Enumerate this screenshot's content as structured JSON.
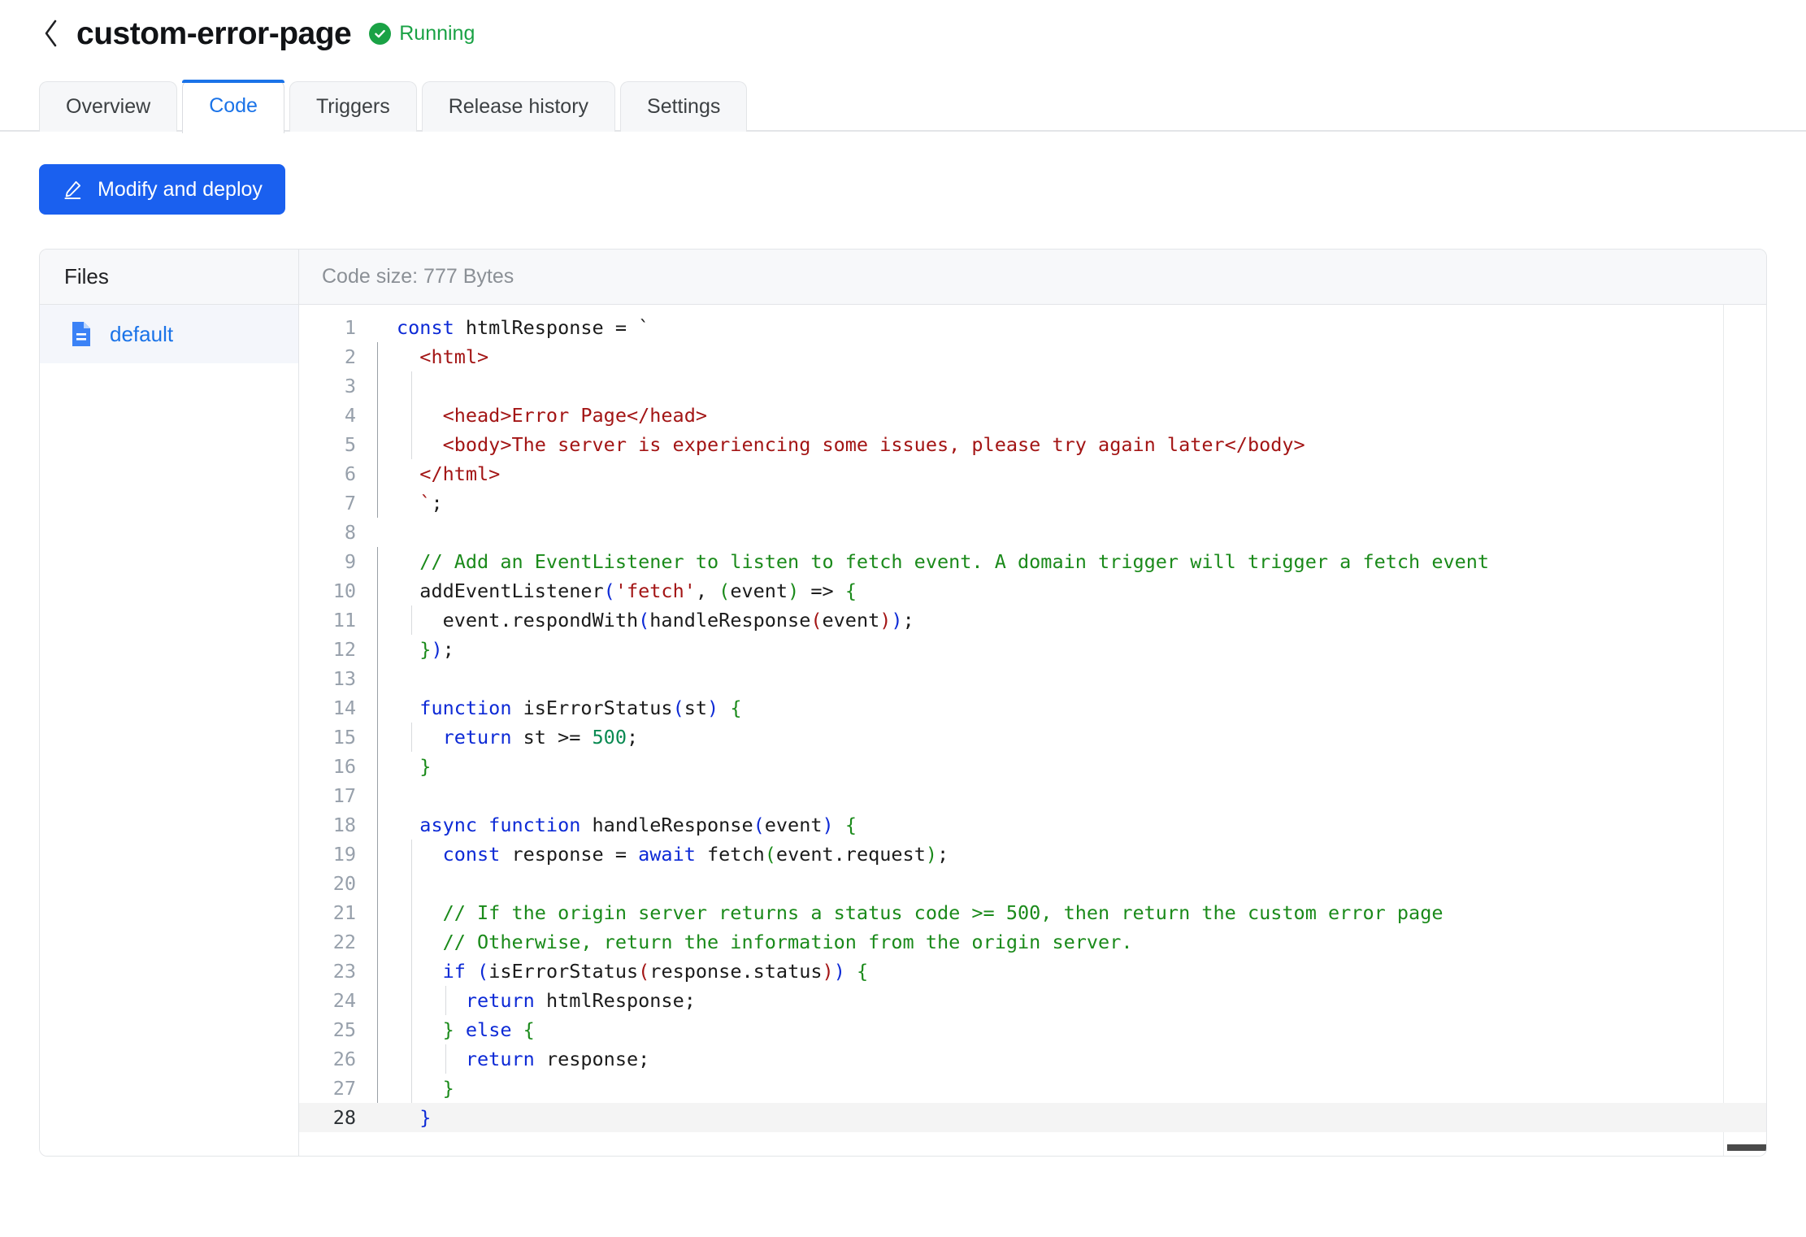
{
  "header": {
    "back_icon": "chevron-left-icon",
    "title": "custom-error-page",
    "status": {
      "icon": "check-circle-icon",
      "label": "Running",
      "color": "#1aa245"
    }
  },
  "tabs": [
    {
      "label": "Overview",
      "active": false
    },
    {
      "label": "Code",
      "active": true
    },
    {
      "label": "Triggers",
      "active": false
    },
    {
      "label": "Release history",
      "active": false
    },
    {
      "label": "Settings",
      "active": false
    }
  ],
  "toolbar": {
    "modify_deploy_label": "Modify and deploy",
    "modify_deploy_icon": "pencil-icon",
    "accent_color": "#1a60ef"
  },
  "files_panel": {
    "header": "Files",
    "items": [
      {
        "icon": "file-document-icon",
        "label": "default",
        "selected": true
      }
    ]
  },
  "editor": {
    "code_size_label": "Code size: 777 Bytes",
    "active_line": 28,
    "lines": [
      {
        "n": "1",
        "indent_levels": 0,
        "tokens": [
          {
            "t": "const ",
            "c": "k"
          },
          {
            "t": "htmlResponse = `",
            "c": "pl"
          }
        ]
      },
      {
        "n": "2",
        "indent_levels": 1,
        "tokens": [
          {
            "t": "  ",
            "c": "pl"
          },
          {
            "t": "<html>",
            "c": "s"
          }
        ]
      },
      {
        "n": "3",
        "indent_levels": 2,
        "tokens": [
          {
            "t": "",
            "c": "pl"
          }
        ]
      },
      {
        "n": "4",
        "indent_levels": 2,
        "tokens": [
          {
            "t": "    ",
            "c": "pl"
          },
          {
            "t": "<head>Error Page</head>",
            "c": "s"
          }
        ]
      },
      {
        "n": "5",
        "indent_levels": 2,
        "tokens": [
          {
            "t": "    ",
            "c": "pl"
          },
          {
            "t": "<body>The server is experiencing some issues, please try again later</body>",
            "c": "s"
          }
        ]
      },
      {
        "n": "6",
        "indent_levels": 1,
        "tokens": [
          {
            "t": "  ",
            "c": "pl"
          },
          {
            "t": "</html>",
            "c": "s"
          }
        ]
      },
      {
        "n": "7",
        "indent_levels": 1,
        "tokens": [
          {
            "t": "  `",
            "c": "s"
          },
          {
            "t": ";",
            "c": "pl"
          }
        ]
      },
      {
        "n": "8",
        "indent_levels": 0,
        "tokens": [
          {
            "t": "",
            "c": "pl"
          }
        ]
      },
      {
        "n": "9",
        "indent_levels": 1,
        "tokens": [
          {
            "t": "  // Add an EventListener to listen to fetch event. A domain trigger will trigger a fetch event",
            "c": "cm"
          }
        ]
      },
      {
        "n": "10",
        "indent_levels": 1,
        "tokens": [
          {
            "t": "  addEventListener",
            "c": "pl"
          },
          {
            "t": "(",
            "c": "p1"
          },
          {
            "t": "'fetch'",
            "c": "s"
          },
          {
            "t": ", ",
            "c": "pl"
          },
          {
            "t": "(",
            "c": "p2"
          },
          {
            "t": "event",
            "c": "pl"
          },
          {
            "t": ")",
            "c": "p2"
          },
          {
            "t": " => ",
            "c": "pl"
          },
          {
            "t": "{",
            "c": "p2"
          }
        ]
      },
      {
        "n": "11",
        "indent_levels": 2,
        "tokens": [
          {
            "t": "    event.respondWith",
            "c": "pl"
          },
          {
            "t": "(",
            "c": "p1"
          },
          {
            "t": "handleResponse",
            "c": "pl"
          },
          {
            "t": "(",
            "c": "p3"
          },
          {
            "t": "event",
            "c": "pl"
          },
          {
            "t": ")",
            "c": "p3"
          },
          {
            "t": ")",
            "c": "p1"
          },
          {
            "t": ";",
            "c": "pl"
          }
        ]
      },
      {
        "n": "12",
        "indent_levels": 1,
        "tokens": [
          {
            "t": "  ",
            "c": "pl"
          },
          {
            "t": "}",
            "c": "p2"
          },
          {
            "t": ")",
            "c": "p1"
          },
          {
            "t": ";",
            "c": "pl"
          }
        ]
      },
      {
        "n": "13",
        "indent_levels": 1,
        "tokens": [
          {
            "t": "",
            "c": "pl"
          }
        ]
      },
      {
        "n": "14",
        "indent_levels": 1,
        "tokens": [
          {
            "t": "  ",
            "c": "pl"
          },
          {
            "t": "function ",
            "c": "k"
          },
          {
            "t": "isErrorStatus",
            "c": "pl"
          },
          {
            "t": "(",
            "c": "p1"
          },
          {
            "t": "st",
            "c": "pl"
          },
          {
            "t": ")",
            "c": "p1"
          },
          {
            "t": " ",
            "c": "pl"
          },
          {
            "t": "{",
            "c": "p2"
          }
        ]
      },
      {
        "n": "15",
        "indent_levels": 2,
        "tokens": [
          {
            "t": "    ",
            "c": "pl"
          },
          {
            "t": "return ",
            "c": "k"
          },
          {
            "t": "st >= ",
            "c": "pl"
          },
          {
            "t": "500",
            "c": "nu"
          },
          {
            "t": ";",
            "c": "pl"
          }
        ]
      },
      {
        "n": "16",
        "indent_levels": 1,
        "tokens": [
          {
            "t": "  ",
            "c": "pl"
          },
          {
            "t": "}",
            "c": "p2"
          }
        ]
      },
      {
        "n": "17",
        "indent_levels": 1,
        "tokens": [
          {
            "t": "",
            "c": "pl"
          }
        ]
      },
      {
        "n": "18",
        "indent_levels": 1,
        "tokens": [
          {
            "t": "  ",
            "c": "pl"
          },
          {
            "t": "async function ",
            "c": "k"
          },
          {
            "t": "handleResponse",
            "c": "pl"
          },
          {
            "t": "(",
            "c": "p1"
          },
          {
            "t": "event",
            "c": "pl"
          },
          {
            "t": ")",
            "c": "p1"
          },
          {
            "t": " ",
            "c": "pl"
          },
          {
            "t": "{",
            "c": "p2"
          }
        ]
      },
      {
        "n": "19",
        "indent_levels": 2,
        "tokens": [
          {
            "t": "    ",
            "c": "pl"
          },
          {
            "t": "const ",
            "c": "k"
          },
          {
            "t": "response = ",
            "c": "pl"
          },
          {
            "t": "await ",
            "c": "k"
          },
          {
            "t": "fetch",
            "c": "pl"
          },
          {
            "t": "(",
            "c": "p2"
          },
          {
            "t": "event.request",
            "c": "pl"
          },
          {
            "t": ")",
            "c": "p2"
          },
          {
            "t": ";",
            "c": "pl"
          }
        ]
      },
      {
        "n": "20",
        "indent_levels": 2,
        "tokens": [
          {
            "t": "",
            "c": "pl"
          }
        ]
      },
      {
        "n": "21",
        "indent_levels": 2,
        "tokens": [
          {
            "t": "    // If the origin server returns a status code >= 500, then return the custom error page",
            "c": "cm"
          }
        ]
      },
      {
        "n": "22",
        "indent_levels": 2,
        "tokens": [
          {
            "t": "    // Otherwise, return the information from the origin server.",
            "c": "cm"
          }
        ]
      },
      {
        "n": "23",
        "indent_levels": 2,
        "tokens": [
          {
            "t": "    ",
            "c": "pl"
          },
          {
            "t": "if",
            "c": "k"
          },
          {
            "t": " ",
            "c": "pl"
          },
          {
            "t": "(",
            "c": "p1"
          },
          {
            "t": "isErrorStatus",
            "c": "pl"
          },
          {
            "t": "(",
            "c": "p3"
          },
          {
            "t": "response.status",
            "c": "pl"
          },
          {
            "t": ")",
            "c": "p3"
          },
          {
            "t": ")",
            "c": "p1"
          },
          {
            "t": " ",
            "c": "pl"
          },
          {
            "t": "{",
            "c": "p2"
          }
        ]
      },
      {
        "n": "24",
        "indent_levels": 3,
        "tokens": [
          {
            "t": "      ",
            "c": "pl"
          },
          {
            "t": "return ",
            "c": "k"
          },
          {
            "t": "htmlResponse;",
            "c": "pl"
          }
        ]
      },
      {
        "n": "25",
        "indent_levels": 2,
        "tokens": [
          {
            "t": "    ",
            "c": "pl"
          },
          {
            "t": "}",
            "c": "p2"
          },
          {
            "t": " ",
            "c": "pl"
          },
          {
            "t": "else",
            "c": "k"
          },
          {
            "t": " ",
            "c": "pl"
          },
          {
            "t": "{",
            "c": "p2"
          }
        ]
      },
      {
        "n": "26",
        "indent_levels": 3,
        "tokens": [
          {
            "t": "      ",
            "c": "pl"
          },
          {
            "t": "return ",
            "c": "k"
          },
          {
            "t": "response;",
            "c": "pl"
          }
        ]
      },
      {
        "n": "27",
        "indent_levels": 2,
        "tokens": [
          {
            "t": "    ",
            "c": "pl"
          },
          {
            "t": "}",
            "c": "p2"
          }
        ]
      },
      {
        "n": "28",
        "indent_levels": 0,
        "tokens": [
          {
            "t": "  ",
            "c": "pl"
          },
          {
            "t": "}",
            "c": "p1"
          }
        ]
      }
    ]
  }
}
